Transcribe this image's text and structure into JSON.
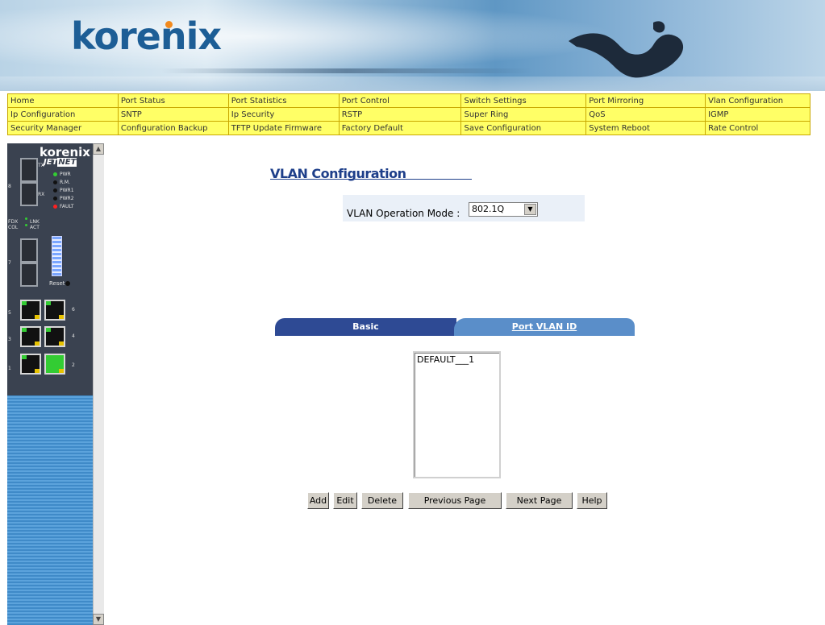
{
  "brand": {
    "logo_text": "korenix"
  },
  "menu": [
    [
      "Home",
      "Port Status",
      "Port Statistics",
      "Port Control",
      "Switch Settings",
      "Port Mirroring",
      "Vlan Configuration"
    ],
    [
      "Ip Configuration",
      "SNTP",
      "Ip Security",
      "RSTP",
      "Super Ring",
      "QoS",
      "IGMP"
    ],
    [
      "Security Manager",
      "Configuration Backup",
      "TFTP Update Firmware",
      "Factory Default",
      "Save Configuration",
      "System Reboot",
      "Rate Control"
    ]
  ],
  "device": {
    "logo": "korenix",
    "model_prefix": "JET",
    "model_suffix": "NET",
    "leds": [
      "PWR",
      "R.M.",
      "PWR1",
      "PWR2",
      "FAULT"
    ],
    "fdx_label": "FDX\nCOL",
    "lnk_label": "LNK\nACT",
    "reset_label": "Reset",
    "tx": "TX",
    "rx": "RX",
    "port_numbers": [
      "8",
      "7",
      "5",
      "6",
      "3",
      "4",
      "1",
      "2"
    ],
    "colors": {
      "pwr": "#33cc33",
      "fault": "#ff2020",
      "off": "#111111"
    }
  },
  "page": {
    "title": "VLAN Configuration",
    "mode_label": "VLAN Operation Mode :",
    "mode_value": "802.1Q",
    "tabs": {
      "basic": "Basic",
      "port_vlan_id": "Port VLAN ID"
    },
    "vlan_list": [
      "DEFAULT___1"
    ],
    "buttons": {
      "add": "Add",
      "edit": "Edit",
      "delete": "Delete",
      "previous": "Previous Page",
      "next": "Next Page",
      "help": "Help"
    }
  },
  "colors": {
    "menu_bg": "#ffff66",
    "menu_border": "#c9a800",
    "title": "#1e3f8a",
    "tab_active": "#2e4a94",
    "tab_inactive": "#5a8ec9"
  }
}
